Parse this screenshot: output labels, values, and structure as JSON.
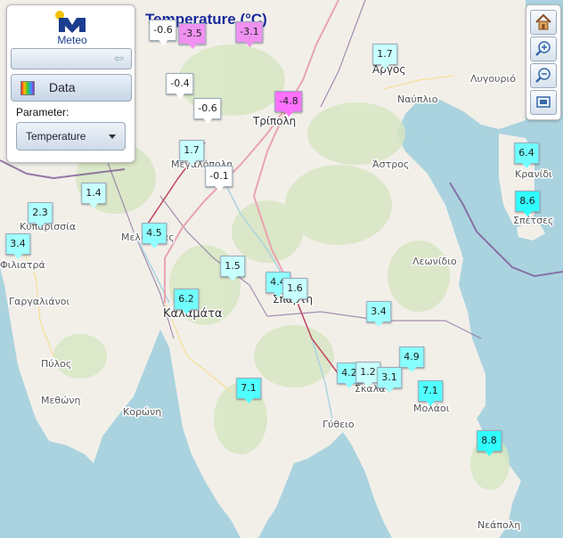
{
  "map": {
    "title": "Temperature (°C)",
    "places": [
      {
        "id": "argos",
        "name": "Άργος",
        "cls": "town"
      },
      {
        "id": "nafplio",
        "name": "Ναύπλιο",
        "cls": "place"
      },
      {
        "id": "lygourio",
        "name": "Λυγουριό",
        "cls": "place"
      },
      {
        "id": "tripoli",
        "name": "Τρίπολη",
        "cls": "town"
      },
      {
        "id": "megalopoli",
        "name": "Μεγαλόπολη",
        "cls": "place"
      },
      {
        "id": "astros",
        "name": "Άστρος",
        "cls": "place"
      },
      {
        "id": "kranidi",
        "name": "Κρανίδι",
        "cls": "place"
      },
      {
        "id": "spetses",
        "name": "Σπέτσες",
        "cls": "place"
      },
      {
        "id": "kyparissia",
        "name": "Κυπαρισσία",
        "cls": "place"
      },
      {
        "id": "meligalas",
        "name": "Μελιγαλάς",
        "cls": "place"
      },
      {
        "id": "filiatra",
        "name": "Φιλιατρά",
        "cls": "place"
      },
      {
        "id": "leonidio",
        "name": "Λεωνίδιο",
        "cls": "place"
      },
      {
        "id": "gargalianoi",
        "name": "Γαργαλιάνοι",
        "cls": "place"
      },
      {
        "id": "kalamata",
        "name": "Καλαμάτα",
        "cls": "city"
      },
      {
        "id": "sparti",
        "name": "Σπάρτη",
        "cls": "town"
      },
      {
        "id": "pylos",
        "name": "Πύλος",
        "cls": "place"
      },
      {
        "id": "skala",
        "name": "Σκάλα",
        "cls": "place"
      },
      {
        "id": "molaoi",
        "name": "Μολάοι",
        "cls": "place"
      },
      {
        "id": "methoni",
        "name": "Μεθώνη",
        "cls": "place"
      },
      {
        "id": "koroni",
        "name": "Κορώνη",
        "cls": "place"
      },
      {
        "id": "gytheio",
        "name": "Γύθειο",
        "cls": "place"
      },
      {
        "id": "neapoli",
        "name": "Νεάπολη",
        "cls": "place"
      }
    ],
    "stations": [
      {
        "value": "-0.6",
        "color": "#ffffff"
      },
      {
        "value": "-3.5",
        "color": "#f090f0"
      },
      {
        "value": "-3.1",
        "color": "#f090f0"
      },
      {
        "value": "1.7",
        "color": "#c8ffff"
      },
      {
        "value": "-0.4",
        "color": "#ffffff"
      },
      {
        "value": "-0.6",
        "color": "#ffffff"
      },
      {
        "value": "-4.8",
        "color": "#ff70ff"
      },
      {
        "value": "1.7",
        "color": "#c8ffff"
      },
      {
        "value": "-0.1",
        "color": "#ffffff"
      },
      {
        "value": "6.4",
        "color": "#70ffff"
      },
      {
        "value": "1.4",
        "color": "#c8ffff"
      },
      {
        "value": "8.6",
        "color": "#30ffff"
      },
      {
        "value": "2.3",
        "color": "#b0ffff"
      },
      {
        "value": "4.5",
        "color": "#90ffff"
      },
      {
        "value": "3.4",
        "color": "#a0ffff"
      },
      {
        "value": "1.5",
        "color": "#c8ffff"
      },
      {
        "value": "4.4",
        "color": "#90ffff"
      },
      {
        "value": "1.6",
        "color": "#c8ffff"
      },
      {
        "value": "6.2",
        "color": "#70ffff"
      },
      {
        "value": "3.4",
        "color": "#a0ffff"
      },
      {
        "value": "4.9",
        "color": "#88ffff"
      },
      {
        "value": "4.2",
        "color": "#90ffff"
      },
      {
        "value": "1.2",
        "color": "#c8ffff"
      },
      {
        "value": "3.1",
        "color": "#a0ffff"
      },
      {
        "value": "7.1",
        "color": "#50ffff"
      },
      {
        "value": "7.1",
        "color": "#50ffff"
      },
      {
        "value": "8.8",
        "color": "#30ffff"
      }
    ]
  },
  "panel": {
    "logo_text": "Meteo",
    "data_button": "Data",
    "parameter_label": "Parameter:",
    "parameter_value": "Temperature"
  },
  "toolbar": {
    "icons": [
      "home-icon",
      "zoom-in-icon",
      "zoom-out-icon",
      "zoom-extent-icon"
    ]
  }
}
